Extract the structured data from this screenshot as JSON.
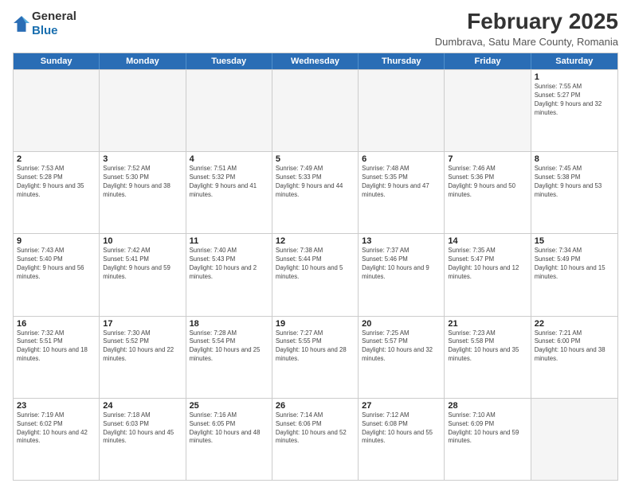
{
  "header": {
    "logo": {
      "general": "General",
      "blue": "Blue"
    },
    "title": "February 2025",
    "subtitle": "Dumbrava, Satu Mare County, Romania"
  },
  "calendar": {
    "weekdays": [
      "Sunday",
      "Monday",
      "Tuesday",
      "Wednesday",
      "Thursday",
      "Friday",
      "Saturday"
    ],
    "weeks": [
      [
        {
          "day": "",
          "info": "",
          "empty": true
        },
        {
          "day": "",
          "info": "",
          "empty": true
        },
        {
          "day": "",
          "info": "",
          "empty": true
        },
        {
          "day": "",
          "info": "",
          "empty": true
        },
        {
          "day": "",
          "info": "",
          "empty": true
        },
        {
          "day": "",
          "info": "",
          "empty": true
        },
        {
          "day": "1",
          "info": "Sunrise: 7:55 AM\nSunset: 5:27 PM\nDaylight: 9 hours and 32 minutes."
        }
      ],
      [
        {
          "day": "2",
          "info": "Sunrise: 7:53 AM\nSunset: 5:28 PM\nDaylight: 9 hours and 35 minutes."
        },
        {
          "day": "3",
          "info": "Sunrise: 7:52 AM\nSunset: 5:30 PM\nDaylight: 9 hours and 38 minutes."
        },
        {
          "day": "4",
          "info": "Sunrise: 7:51 AM\nSunset: 5:32 PM\nDaylight: 9 hours and 41 minutes."
        },
        {
          "day": "5",
          "info": "Sunrise: 7:49 AM\nSunset: 5:33 PM\nDaylight: 9 hours and 44 minutes."
        },
        {
          "day": "6",
          "info": "Sunrise: 7:48 AM\nSunset: 5:35 PM\nDaylight: 9 hours and 47 minutes."
        },
        {
          "day": "7",
          "info": "Sunrise: 7:46 AM\nSunset: 5:36 PM\nDaylight: 9 hours and 50 minutes."
        },
        {
          "day": "8",
          "info": "Sunrise: 7:45 AM\nSunset: 5:38 PM\nDaylight: 9 hours and 53 minutes."
        }
      ],
      [
        {
          "day": "9",
          "info": "Sunrise: 7:43 AM\nSunset: 5:40 PM\nDaylight: 9 hours and 56 minutes."
        },
        {
          "day": "10",
          "info": "Sunrise: 7:42 AM\nSunset: 5:41 PM\nDaylight: 9 hours and 59 minutes."
        },
        {
          "day": "11",
          "info": "Sunrise: 7:40 AM\nSunset: 5:43 PM\nDaylight: 10 hours and 2 minutes."
        },
        {
          "day": "12",
          "info": "Sunrise: 7:38 AM\nSunset: 5:44 PM\nDaylight: 10 hours and 5 minutes."
        },
        {
          "day": "13",
          "info": "Sunrise: 7:37 AM\nSunset: 5:46 PM\nDaylight: 10 hours and 9 minutes."
        },
        {
          "day": "14",
          "info": "Sunrise: 7:35 AM\nSunset: 5:47 PM\nDaylight: 10 hours and 12 minutes."
        },
        {
          "day": "15",
          "info": "Sunrise: 7:34 AM\nSunset: 5:49 PM\nDaylight: 10 hours and 15 minutes."
        }
      ],
      [
        {
          "day": "16",
          "info": "Sunrise: 7:32 AM\nSunset: 5:51 PM\nDaylight: 10 hours and 18 minutes."
        },
        {
          "day": "17",
          "info": "Sunrise: 7:30 AM\nSunset: 5:52 PM\nDaylight: 10 hours and 22 minutes."
        },
        {
          "day": "18",
          "info": "Sunrise: 7:28 AM\nSunset: 5:54 PM\nDaylight: 10 hours and 25 minutes."
        },
        {
          "day": "19",
          "info": "Sunrise: 7:27 AM\nSunset: 5:55 PM\nDaylight: 10 hours and 28 minutes."
        },
        {
          "day": "20",
          "info": "Sunrise: 7:25 AM\nSunset: 5:57 PM\nDaylight: 10 hours and 32 minutes."
        },
        {
          "day": "21",
          "info": "Sunrise: 7:23 AM\nSunset: 5:58 PM\nDaylight: 10 hours and 35 minutes."
        },
        {
          "day": "22",
          "info": "Sunrise: 7:21 AM\nSunset: 6:00 PM\nDaylight: 10 hours and 38 minutes."
        }
      ],
      [
        {
          "day": "23",
          "info": "Sunrise: 7:19 AM\nSunset: 6:02 PM\nDaylight: 10 hours and 42 minutes."
        },
        {
          "day": "24",
          "info": "Sunrise: 7:18 AM\nSunset: 6:03 PM\nDaylight: 10 hours and 45 minutes."
        },
        {
          "day": "25",
          "info": "Sunrise: 7:16 AM\nSunset: 6:05 PM\nDaylight: 10 hours and 48 minutes."
        },
        {
          "day": "26",
          "info": "Sunrise: 7:14 AM\nSunset: 6:06 PM\nDaylight: 10 hours and 52 minutes."
        },
        {
          "day": "27",
          "info": "Sunrise: 7:12 AM\nSunset: 6:08 PM\nDaylight: 10 hours and 55 minutes."
        },
        {
          "day": "28",
          "info": "Sunrise: 7:10 AM\nSunset: 6:09 PM\nDaylight: 10 hours and 59 minutes."
        },
        {
          "day": "",
          "info": "",
          "empty": true
        }
      ]
    ]
  }
}
